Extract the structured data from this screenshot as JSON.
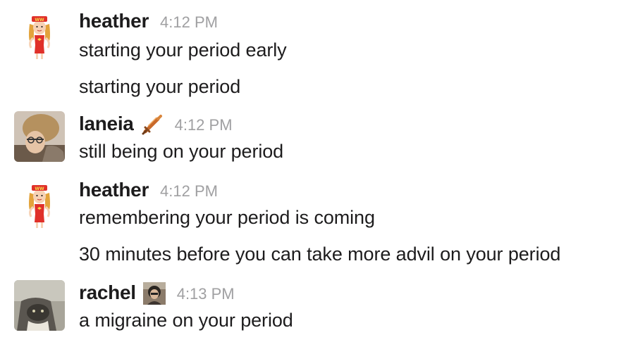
{
  "messages": [
    {
      "user": "heather",
      "time": "4:12 PM",
      "lines": [
        "starting your period early",
        "starting your period"
      ]
    },
    {
      "user": "laneia",
      "time": "4:12 PM",
      "badge": "sword-emoji-icon",
      "lines": [
        "still being on your period"
      ]
    },
    {
      "user": "heather",
      "time": "4:12 PM",
      "lines": [
        "remembering your period is coming",
        "30 minutes before you can take more advil on your period"
      ]
    },
    {
      "user": "rachel",
      "time": "4:13 PM",
      "badge": "profile-photo-emoji-icon",
      "lines": [
        "a migraine on your period"
      ]
    }
  ],
  "icons": {
    "heather_avatar": "wonder-woman-cartoon-avatar",
    "laneia_avatar": "user-photo-avatar",
    "rachel_avatar": "user-photo-avatar"
  },
  "colors": {
    "name": "#1d1c1d",
    "timestamp": "#a0a0a2",
    "text": "#1d1c1d"
  }
}
